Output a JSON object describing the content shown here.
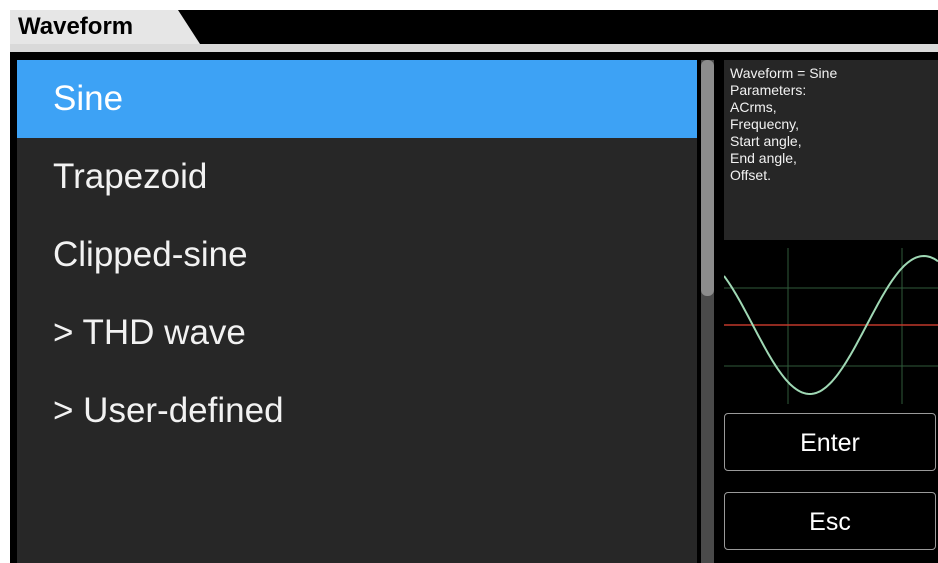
{
  "header": {
    "title": "Waveform"
  },
  "waveform_list": {
    "items": [
      {
        "label": "Sine",
        "selected": true
      },
      {
        "label": "Trapezoid",
        "selected": false
      },
      {
        "label": "Clipped-sine",
        "selected": false
      },
      {
        "label": "> THD wave",
        "selected": false
      },
      {
        "label": "> User-defined",
        "selected": false
      }
    ]
  },
  "info": {
    "lines": [
      "Waveform = Sine",
      "Parameters:",
      "ACrms,",
      "Frequecny,",
      "Start angle,",
      "End angle,",
      "Offset."
    ]
  },
  "preview": {
    "waveform": "sine",
    "trace_color": "#9fd8b4",
    "axis_color": "#c0392b",
    "grid_color": "#2f5a3a"
  },
  "buttons": {
    "enter_label": "Enter",
    "esc_label": "Esc"
  },
  "colors": {
    "selection": "#3da2f5",
    "panel": "#272727",
    "background": "#000000"
  }
}
